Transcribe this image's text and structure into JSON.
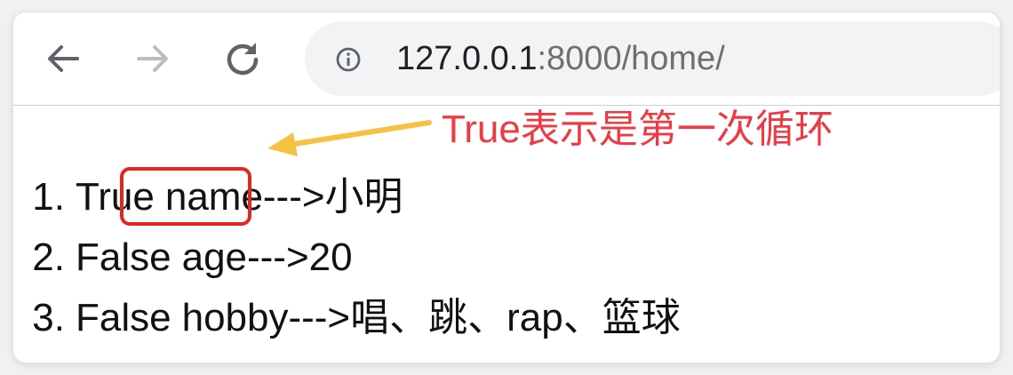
{
  "browser": {
    "nav": {
      "back_icon": "arrow-left-icon",
      "forward_icon": "arrow-right-icon",
      "reload_icon": "reload-icon"
    },
    "omnibox": {
      "info_icon": "info-icon",
      "url_host": "127.0.0.1",
      "url_rest": ":8000/home/"
    }
  },
  "annotation": {
    "text": "True表示是第一次循环",
    "color": "#ee3a43",
    "arrow_color": "#f5c242",
    "box_color": "#e5261f"
  },
  "list": {
    "items": [
      {
        "num": "1.",
        "flag": "True",
        "text": "name--->小明"
      },
      {
        "num": "2.",
        "flag": "False",
        "text": "age--->20"
      },
      {
        "num": "3.",
        "flag": "False",
        "text": "hobby--->唱、跳、rap、篮球"
      }
    ]
  }
}
